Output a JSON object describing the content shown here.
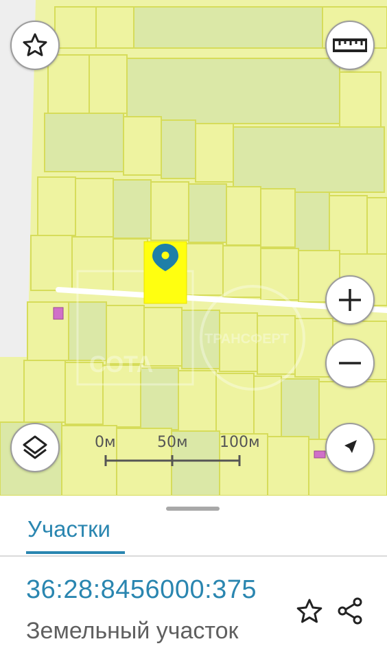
{
  "map": {
    "colors": {
      "background": "#e4ecd4",
      "parcel_fill": "#eef3a0",
      "parcel_alt_fill": "#dbe8a7",
      "parcel_border": "#d8de5e",
      "selected_parcel": "#ffff10",
      "pin": "#1e7fa8",
      "road": "#ffffff"
    },
    "watermarks": [
      "СОТА",
      "ТРАНСФЕРТ"
    ],
    "scale_bar": {
      "labels": [
        "0м",
        "50м",
        "100м"
      ]
    },
    "controls": {
      "favorite": "star-icon",
      "ruler": "ruler-icon",
      "zoom_in": "plus-icon",
      "zoom_out": "minus-icon",
      "layers": "layers-icon",
      "my_location": "navigation-arrow-icon"
    }
  },
  "sheet": {
    "tab_label": "Участки",
    "cadastral_number": "36:28:8456000:375",
    "parcel_type": "Земельный участок",
    "actions": [
      "star-icon",
      "share-icon"
    ]
  }
}
